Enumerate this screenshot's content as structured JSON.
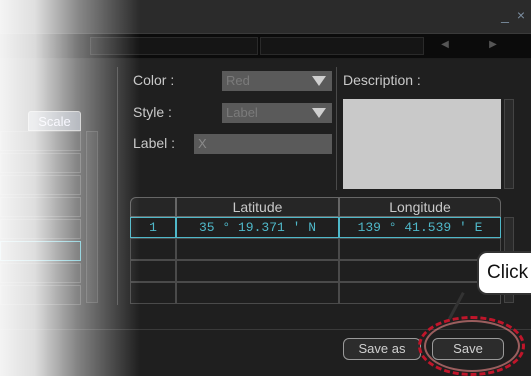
{
  "window": {
    "controls": "_ ×"
  },
  "form": {
    "color_label": "Color :",
    "color_value": "Red",
    "style_label": "Style :",
    "style_value": "Label",
    "label_label": "Label :",
    "label_value": "X",
    "description_label": "Description :"
  },
  "left_panel": {
    "scale_tab": "Scale"
  },
  "table": {
    "headers": [
      "",
      "Latitude",
      "Longitude"
    ],
    "rows": [
      [
        "1",
        "35 ° 19.371 ' N",
        "139 ° 41.539 ' E"
      ]
    ]
  },
  "buttons": {
    "save_as": "Save as",
    "save": "Save"
  },
  "callout": {
    "text": "Click"
  },
  "colors": {
    "highlight": "#4fb8c9",
    "annotation_ring": "#c0152a"
  }
}
